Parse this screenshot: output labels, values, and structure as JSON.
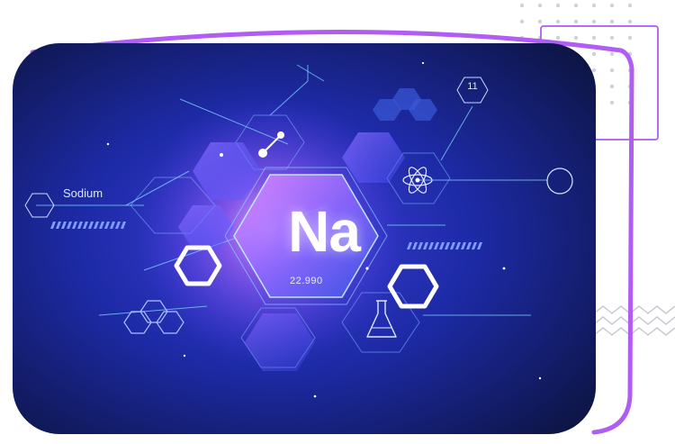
{
  "element": {
    "name": "Sodium",
    "symbol": "Na",
    "atomic_mass": "22.990",
    "atomic_number": "11"
  },
  "colors": {
    "card_dark": "#0b1238",
    "card_mid": "#1d2aa6",
    "accent_purple": "#b15cf2",
    "glow_pink": "#d78bff",
    "line_cyan": "#7fd8ff"
  },
  "icons": [
    "molecule-icon",
    "atom-icon",
    "flask-icon",
    "hexagon-outline-icon"
  ]
}
